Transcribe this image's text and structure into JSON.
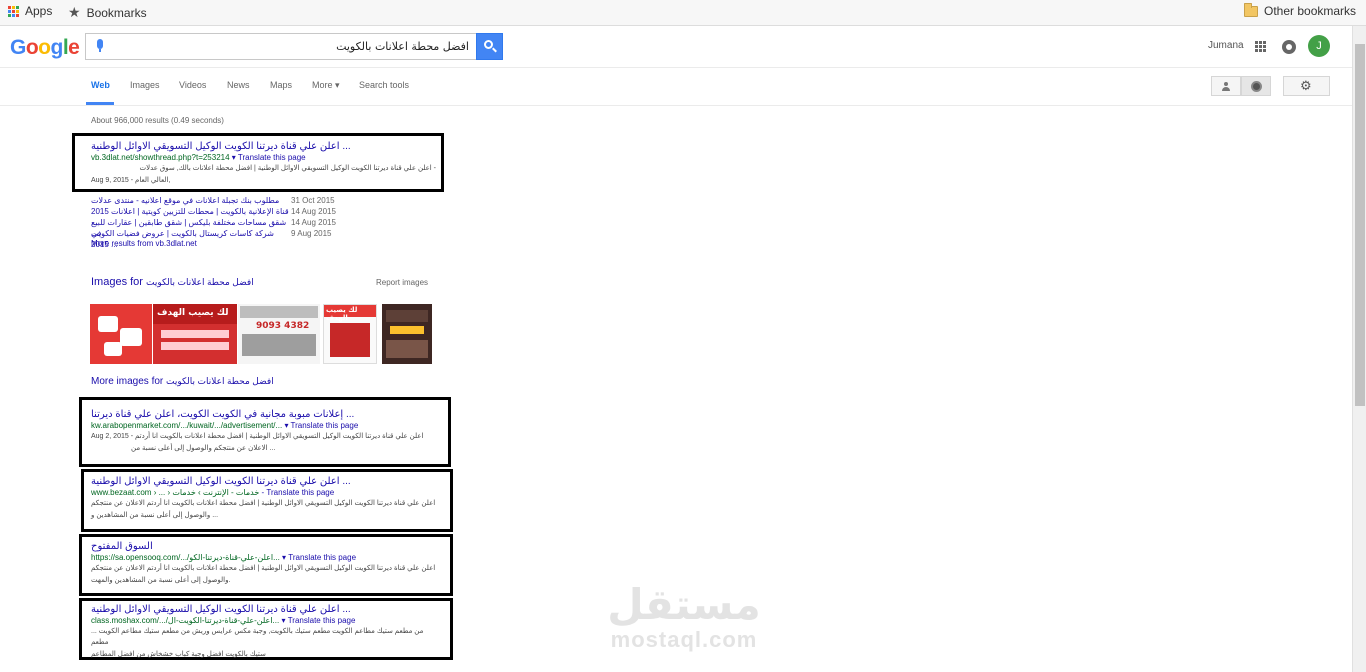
{
  "bookmarks_bar": {
    "apps_label": "Apps",
    "bookmarks_label": "Bookmarks",
    "other_bookmarks_label": "Other bookmarks"
  },
  "header": {
    "logo_letters": [
      "G",
      "o",
      "o",
      "g",
      "l",
      "e"
    ],
    "logo_colors": [
      "#4285f4",
      "#ea4335",
      "#fbbc05",
      "#4285f4",
      "#34a853",
      "#ea4335"
    ],
    "search_query": "افضل محطة اعلانات بالكويت",
    "user_name": "Jumana",
    "avatar_initial": "J"
  },
  "tabs": [
    "Web",
    "Images",
    "Videos",
    "News",
    "Maps",
    "More ▾",
    "Search tools"
  ],
  "active_tab": "Web",
  "stats": "About 966,000 results (0.49 seconds)",
  "results": [
    {
      "title": "اعلن علي قناة ديرتنا الكويت الوكيل التسويقي الاوائل الوطنية ...",
      "cite": "vb.3dlat.net/showthread.php?t=253214",
      "translate": "▾ Translate this page",
      "snippet_1": "اعلن علي قناة ديرتنا الكويت الوكيل التسويقي الاوائل الوطنية | افضل محطة اعلانات بالك, سوق عدلات -",
      "snippet_2": "Aug 9, 2015 - العالي العام,"
    },
    {
      "title": "إعلانات مبوبة مجانية في الكويت الكويت، اعلن علي قناة ديرتنا ...",
      "cite": "kw.arabopenmarket.com/.../kuwait/.../advertisement/...",
      "translate": "▾ Translate this page",
      "snippet_1": "Aug 2, 2015 - اعلن علي قناة ديرتنا الكويت الوكيل التسويقي الاوائل الوطنية | افضل محطة اعلانات بالكويت انا أردتم",
      "snippet_2": "الاعلان عن منتجكم والوصول إلى أعلى نسبة من ..."
    },
    {
      "title": "اعلن علي قناة ديرتنا الكويت الوكيل التسويقي الاوائل الوطنية ...",
      "cite": "www.bezaat.com › ... › خدمات - الإنترنت › خدمات",
      "translate": "- Translate this page",
      "snippet_1": "اعلن علي قناة ديرتنا الكويت الوكيل التسويقي الاوائل الوطنية | افضل محطة اعلانات بالكويت انا أردتم الاعلان عن منتجكم",
      "snippet_2": "والوصول إلى أعلى نسبة من المشاهدين و ..."
    },
    {
      "title": "السوق المفتوح",
      "cite": "https://sa.opensooq.com/.../اعلن-علي-قناة-ديرتنا-الكو...",
      "translate": "▾ Translate this page",
      "snippet_1": "اعلن علي قناة ديرتنا الكويت الوكيل التسويقي الاوائل الوطنية | افضل محطة اعلانات بالكويت انا أردتم الاعلان عن منتجكم",
      "snippet_2": "والوصول إلى أعلى نسبة من المشاهدين والمهت."
    },
    {
      "title": "اعلن علي قناة ديرتنا الكويت الوكيل التسويقي الاوائل الوطنية ...",
      "cite": "class.moshax.com/.../اعلن-علي-قناة-ديرتنا-الكويت-ال...",
      "translate": "▾ Translate this page",
      "snippet_1": "... من مطعم ستيك مطاعم الكويت مطعم ستيك بالكويت, وجبة مكس عرايس وريش من مطعم ستيك مطاعم الكويت مطعم",
      "snippet_2": "ستيك بالكويت افضل وجبة كباب خشخاش من افضل المطاعم"
    }
  ],
  "sitelinks": [
    {
      "title": "مطلوب بنك تجبلة اعلانات في موقع اعلانيه - منتدى عدلات",
      "date": "31 Oct 2015"
    },
    {
      "title": "قناة الإعلانية بالكويت | محطات للتزيين كويتية | اعلانات 2015 ...",
      "date": "14 Aug 2015"
    },
    {
      "title": "شقق مساحات مختلفة بليكس | شقق طابقين | عقارات للبيع في",
      "date": "14 Aug 2015"
    },
    {
      "title": "شركة كاسات كريستال بالكويت | عروض فضيات الكويت 2015 ...",
      "date": "9 Aug 2015"
    }
  ],
  "more_results_label": "More results from vb.3dlat.net",
  "images_section": {
    "heading_prefix": "Images for",
    "heading_query": "افضل محطة اعلانات بالكويت",
    "report_label": "Report images",
    "more_prefix": "More images for",
    "more_query": "افضل محطة اعلانات بالكويت",
    "thumb_texts": [
      "",
      "لك يصيب الهدف",
      "9093 4382",
      "لك يصيب الهدف",
      ""
    ]
  },
  "watermark": {
    "arabic": "مستقل",
    "latin": "mostaql.com"
  }
}
